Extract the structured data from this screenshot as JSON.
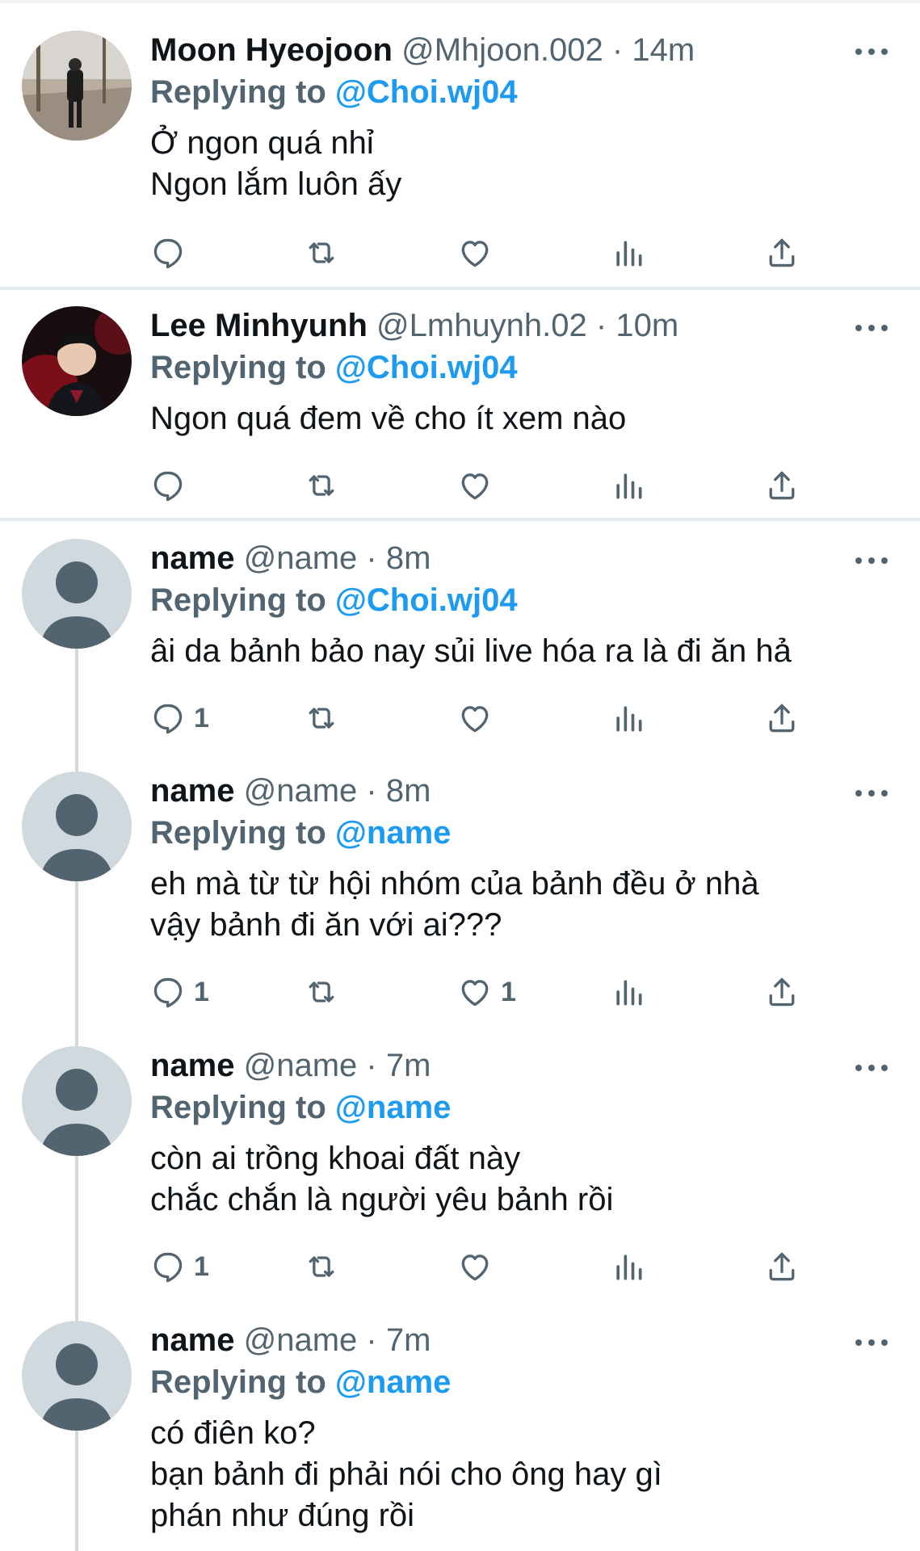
{
  "tweets": [
    {
      "name": "Moon Hyeojoon",
      "handle": "@Mhjoon.002",
      "time": "14m",
      "replying_label": "Replying to",
      "replying_to": "@Choi.wj04",
      "lines": [
        "Ở ngon quá nhỉ",
        "Ngon lắm luôn ấy"
      ],
      "counts": {
        "reply": "",
        "retweet": "",
        "like": ""
      }
    },
    {
      "name": "Lee Minhyunh",
      "handle": "@Lmhuynh.02",
      "time": "10m",
      "replying_label": "Replying to",
      "replying_to": "@Choi.wj04",
      "lines": [
        "Ngon quá đem về cho ít xem nào"
      ],
      "counts": {
        "reply": "",
        "retweet": "",
        "like": ""
      }
    },
    {
      "name": "name",
      "handle": "@name",
      "time": "8m",
      "replying_label": "Replying to",
      "replying_to": "@Choi.wj04",
      "lines": [
        "âi da bảnh bảo nay sủi live hóa ra là đi ăn hả"
      ],
      "counts": {
        "reply": "1",
        "retweet": "",
        "like": ""
      }
    },
    {
      "name": "name",
      "handle": "@name",
      "time": "8m",
      "replying_label": "Replying to",
      "replying_to": "@name",
      "lines": [
        "eh mà từ từ hội nhóm của bảnh đều ở nhà",
        "vậy bảnh đi ăn với ai???"
      ],
      "counts": {
        "reply": "1",
        "retweet": "",
        "like": "1"
      }
    },
    {
      "name": "name",
      "handle": "@name",
      "time": "7m",
      "replying_label": "Replying to",
      "replying_to": "@name",
      "lines": [
        "còn ai trồng khoai đất này",
        "chắc chắn là người yêu bảnh rồi"
      ],
      "counts": {
        "reply": "1",
        "retweet": "",
        "like": ""
      }
    },
    {
      "name": "name",
      "handle": "@name",
      "time": "7m",
      "replying_label": "Replying to",
      "replying_to": "@name",
      "lines": [
        "có điên ko?",
        "bạn bảnh đi phải nói cho ông hay gì",
        "phán như đúng rồi"
      ],
      "counts": {
        "reply": "",
        "retweet": "",
        "like": ""
      }
    }
  ],
  "separator_dot": "·",
  "icons": [
    "reply-icon",
    "retweet-icon",
    "like-icon",
    "views-icon",
    "share-icon",
    "more-icon"
  ],
  "colors": {
    "accent": "#1d9bf0",
    "muted": "#536471",
    "text": "#0f1419",
    "placeholder": "#cfd9de"
  }
}
